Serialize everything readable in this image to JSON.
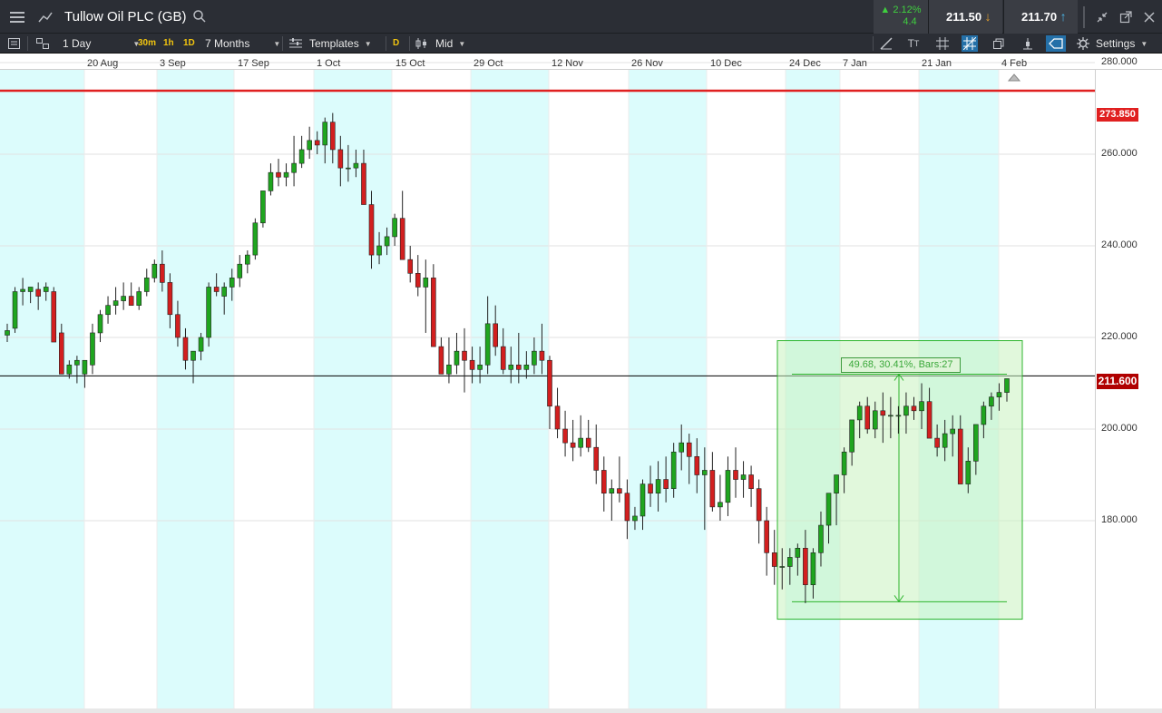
{
  "header": {
    "instrument": "Tullow Oil PLC (GB)",
    "change_pct": "▲ 2.12%",
    "change_abs": "4.4",
    "sell_price": "211.50",
    "buy_price": "211.70"
  },
  "toolbar": {
    "interval": "1 Day",
    "quick_30m": "30m",
    "quick_1h": "1h",
    "quick_1d": "1D",
    "range": "7 Months",
    "templates": "Templates",
    "d_button": "D",
    "price_type": "Mid",
    "settings": "Settings"
  },
  "chart": {
    "x_labels": [
      "20 Aug",
      "3 Sep",
      "17 Sep",
      "1 Oct",
      "15 Oct",
      "29 Oct",
      "12 Nov",
      "26 Nov",
      "10 Dec",
      "24 Dec",
      "7 Jan",
      "21 Jan",
      "4 Feb"
    ],
    "y_labels": [
      "280.000",
      "260.000",
      "240.000",
      "220.000",
      "200.000",
      "180.000"
    ],
    "resistance_label": "273.850",
    "current_price_label": "211.600",
    "measure_label": "49.68, 30.41%, Bars:27"
  },
  "chart_data": {
    "type": "candlestick",
    "title": "Tullow Oil PLC (GB)",
    "interval": "1 Day",
    "range": "7 Months",
    "ylim": [
      160,
      280
    ],
    "x_ticks": [
      "20 Aug",
      "3 Sep",
      "17 Sep",
      "1 Oct",
      "15 Oct",
      "29 Oct",
      "12 Nov",
      "26 Nov",
      "10 Dec",
      "24 Dec",
      "7 Jan",
      "21 Jan",
      "4 Feb"
    ],
    "y_ticks": [
      280,
      260,
      240,
      220,
      200,
      180
    ],
    "horizontal_lines": [
      {
        "value": 273.85,
        "color": "#e02020"
      },
      {
        "value": 211.6,
        "color": "#000000"
      }
    ],
    "measure": {
      "start": 162.3,
      "end": 211.98,
      "change": 49.68,
      "pct": 30.41,
      "bars": 27
    },
    "candles": [
      [
        220.5,
        223,
        219,
        221.5
      ],
      [
        222,
        231,
        221,
        230
      ],
      [
        230,
        233,
        227,
        230.5
      ],
      [
        230,
        231,
        227.5,
        231
      ],
      [
        230.5,
        232,
        226,
        229
      ],
      [
        230,
        232,
        228,
        231
      ],
      [
        230,
        231,
        221,
        219
      ],
      [
        221,
        223,
        212,
        212
      ],
      [
        212,
        215,
        211,
        214
      ],
      [
        214,
        216,
        210,
        215
      ],
      [
        212,
        214,
        209,
        215
      ],
      [
        214,
        223,
        212,
        221
      ],
      [
        221,
        226,
        219,
        225
      ],
      [
        225,
        229,
        223,
        227
      ],
      [
        227,
        231,
        225,
        228
      ],
      [
        228,
        232,
        226,
        229
      ],
      [
        229,
        232,
        227,
        227
      ],
      [
        227,
        231,
        226,
        230
      ],
      [
        230,
        235,
        229,
        233
      ],
      [
        233,
        237,
        232,
        236
      ],
      [
        236,
        239,
        230,
        232
      ],
      [
        232,
        234,
        222,
        225
      ],
      [
        225,
        228,
        218,
        220
      ],
      [
        220,
        222,
        213,
        215
      ],
      [
        215,
        217,
        210,
        217
      ],
      [
        217,
        221,
        215,
        220
      ],
      [
        220,
        232,
        218,
        231
      ],
      [
        231,
        234,
        229,
        230
      ],
      [
        229,
        232,
        225,
        231
      ],
      [
        231,
        235,
        228,
        233
      ],
      [
        233,
        238,
        231,
        236
      ],
      [
        236,
        239,
        234,
        238
      ],
      [
        238,
        246,
        237,
        245
      ],
      [
        245,
        251,
        244,
        252
      ],
      [
        252,
        258,
        251,
        256
      ],
      [
        256,
        259,
        253,
        255
      ],
      [
        255,
        258,
        253,
        256
      ],
      [
        256,
        264,
        253,
        258
      ],
      [
        258,
        264,
        257,
        261
      ],
      [
        261,
        266,
        259,
        263
      ],
      [
        263,
        265,
        260,
        262
      ],
      [
        262,
        268,
        258,
        267
      ],
      [
        267,
        269,
        258,
        261
      ],
      [
        261,
        264,
        253,
        257
      ],
      [
        257,
        262,
        254,
        257
      ],
      [
        257,
        261,
        255,
        258
      ],
      [
        258,
        261,
        253,
        249
      ],
      [
        249,
        252,
        235,
        238
      ],
      [
        238,
        243,
        236,
        240
      ],
      [
        240,
        244,
        238,
        242
      ],
      [
        242,
        247,
        240,
        246
      ],
      [
        246,
        252,
        243,
        237
      ],
      [
        237,
        240,
        232,
        234
      ],
      [
        234,
        238,
        229,
        231
      ],
      [
        231,
        237,
        221,
        233
      ],
      [
        233,
        236,
        220,
        218
      ],
      [
        218,
        220,
        212,
        212
      ],
      [
        212,
        220,
        210,
        214
      ],
      [
        214,
        221,
        212,
        217
      ],
      [
        217,
        222,
        208,
        215
      ],
      [
        215,
        218,
        210,
        213
      ],
      [
        213,
        218,
        210,
        214
      ],
      [
        214,
        229,
        212,
        223
      ],
      [
        223,
        227,
        216,
        218
      ],
      [
        218,
        222,
        212,
        213
      ],
      [
        213,
        218,
        210,
        214
      ],
      [
        214,
        221,
        210,
        213
      ],
      [
        213,
        217,
        211,
        214
      ],
      [
        214,
        220,
        212,
        217
      ],
      [
        217,
        223,
        212,
        215
      ],
      [
        215,
        216,
        200,
        205
      ],
      [
        205,
        209,
        198,
        200
      ],
      [
        200,
        204,
        194,
        197
      ],
      [
        197,
        202,
        193,
        196
      ],
      [
        196,
        203,
        194,
        198
      ],
      [
        198,
        202,
        195,
        196
      ],
      [
        196,
        201,
        188,
        191
      ],
      [
        191,
        194,
        182,
        186
      ],
      [
        186,
        189,
        180,
        187
      ],
      [
        187,
        194,
        184,
        186
      ],
      [
        186,
        189,
        176,
        180
      ],
      [
        180,
        183,
        178,
        181
      ],
      [
        181,
        189,
        178,
        188
      ],
      [
        188,
        192,
        183,
        186
      ],
      [
        186,
        193,
        182,
        189
      ],
      [
        189,
        194,
        184,
        187
      ],
      [
        187,
        197,
        185,
        195
      ],
      [
        195,
        201,
        191,
        197
      ],
      [
        197,
        199,
        188,
        194
      ],
      [
        194,
        198,
        186,
        190
      ],
      [
        190,
        196,
        178,
        191
      ],
      [
        191,
        195,
        182,
        183
      ],
      [
        183,
        190,
        180,
        184
      ],
      [
        184,
        194,
        181,
        191
      ],
      [
        191,
        196,
        185,
        189
      ],
      [
        189,
        193,
        185,
        190
      ],
      [
        190,
        192,
        183,
        187
      ],
      [
        187,
        189,
        175,
        180
      ],
      [
        180,
        183,
        168,
        173
      ],
      [
        173,
        178,
        166,
        170
      ],
      [
        170,
        174,
        165,
        170
      ],
      [
        170,
        174,
        166,
        172
      ],
      [
        172,
        175,
        168,
        174
      ],
      [
        174,
        178,
        162,
        166
      ],
      [
        166,
        174,
        163,
        173
      ],
      [
        173,
        182,
        170,
        179
      ],
      [
        179,
        186,
        175,
        186
      ],
      [
        186,
        190,
        179,
        190
      ],
      [
        190,
        196,
        186,
        195
      ],
      [
        195,
        201,
        192,
        202
      ],
      [
        202,
        206,
        198,
        205
      ],
      [
        205,
        207,
        199,
        200
      ],
      [
        200,
        206,
        198,
        204
      ],
      [
        204,
        208,
        197,
        203
      ],
      [
        203,
        207,
        198,
        203
      ],
      [
        203,
        205,
        199,
        203
      ],
      [
        203,
        208,
        199,
        205
      ],
      [
        205,
        207,
        202,
        204
      ],
      [
        204,
        210,
        200,
        206
      ],
      [
        206,
        209,
        201,
        198
      ],
      [
        198,
        201,
        194,
        196
      ],
      [
        196,
        202,
        193,
        199
      ],
      [
        199,
        203,
        194,
        200
      ],
      [
        200,
        203,
        193,
        188
      ],
      [
        188,
        196,
        186,
        193
      ],
      [
        193,
        198,
        190,
        201
      ],
      [
        201,
        206,
        198,
        205
      ],
      [
        205,
        208,
        202,
        207
      ],
      [
        207,
        210,
        204,
        208
      ],
      [
        208,
        211,
        206,
        211
      ]
    ]
  }
}
